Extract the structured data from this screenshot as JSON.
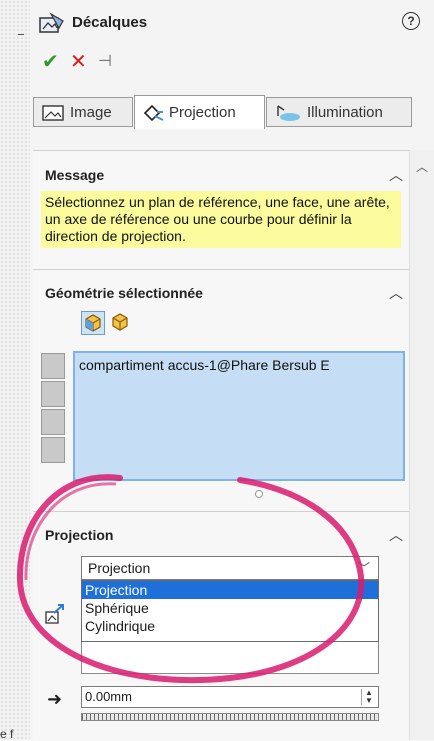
{
  "header": {
    "title": "Décalques",
    "help_label": "?"
  },
  "confirm": {
    "ok": "✔",
    "cancel": "✕",
    "pin": "⊣"
  },
  "tabs": [
    {
      "label": "Image",
      "icon": "image-icon"
    },
    {
      "label": "Projection",
      "icon": "projection-tab-icon"
    },
    {
      "label": "Illumination",
      "icon": "illumination-icon"
    }
  ],
  "message": {
    "title": "Message",
    "text": "Sélectionnez un plan de référence, une face, une arête, un axe de référence ou une courbe pour définir la direction de projection."
  },
  "geometry": {
    "title": "Géométrie sélectionnée",
    "items": [
      "compartiment accus-1@Phare Bersub E"
    ]
  },
  "projection": {
    "title": "Projection",
    "selected": "Projection",
    "options": [
      "Projection",
      "Sphérique",
      "Cylindrique"
    ],
    "distance": "0.00mm"
  },
  "misc": {
    "clipped_edge_text": "e f"
  },
  "colors": {
    "message_bg": "#fbfb9e",
    "selection_bg": "#c6def5",
    "dropdown_highlight": "#1e6fd9",
    "annotation": "#d81b6e"
  }
}
